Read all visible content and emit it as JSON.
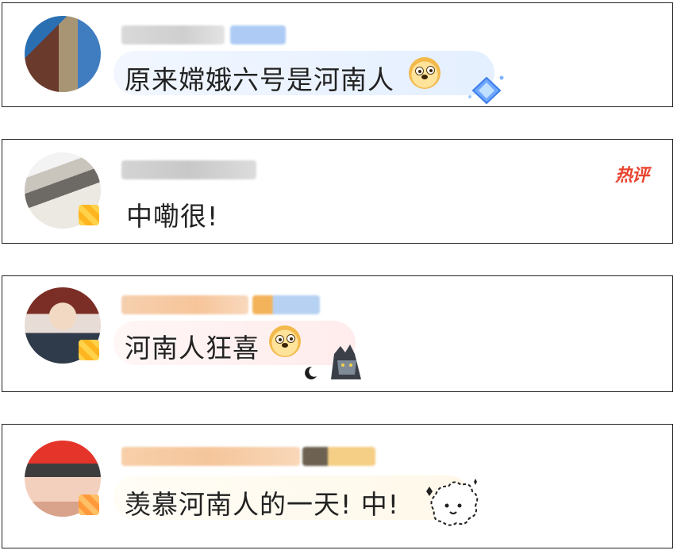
{
  "comments": [
    {
      "text": "原来嫦娥六号是河南人",
      "emoji": "doge-emoji"
    },
    {
      "text": "中嘞很!",
      "badge": "热评"
    },
    {
      "text": "河南人狂喜",
      "emoji": "doge-emoji"
    },
    {
      "text": "羡慕河南人的一天! 中!"
    }
  ],
  "colors": {
    "hot_badge": "#e8432e",
    "bubble_blue": "#eaf3ff",
    "bubble_pink": "#fff1f1",
    "bubble_cream": "#fffaf0",
    "card_border": "#222222"
  }
}
